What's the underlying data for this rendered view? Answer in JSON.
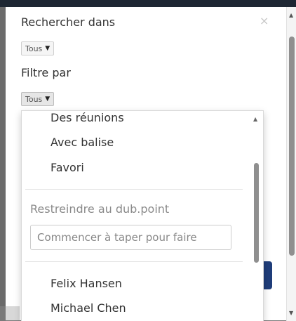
{
  "dialog": {
    "search_in_label": "Rechercher dans",
    "search_in_value": "Tous",
    "filter_by_label": "Filtre par",
    "filter_by_value": "Tous",
    "close_symbol": "×"
  },
  "dropdown": {
    "items": [
      "Des réunions",
      "Avec balise",
      "Favori"
    ],
    "restrict_label": "Restreindre au dub.point",
    "restrict_placeholder": "Commencer à taper pour faire",
    "people": [
      "Felix Hansen",
      "Michael Chen"
    ]
  },
  "icons": {
    "close": "close-icon",
    "caret": "caret-down-icon",
    "scroll_up": "scroll-up-arrow-icon",
    "scroll_down": "scroll-down-arrow-icon"
  },
  "colors": {
    "topbar": "#1e2733",
    "accent_blue": "#1f3d7a",
    "backdrop": "#6b6b6b"
  }
}
